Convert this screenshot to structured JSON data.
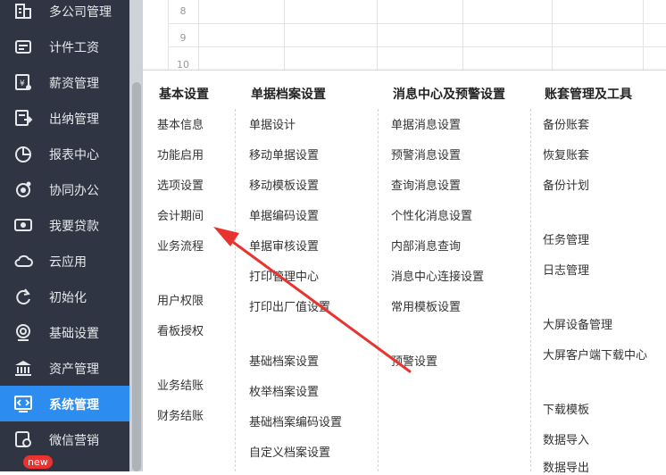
{
  "sidebar": {
    "items": [
      {
        "label": "多公司管理",
        "icon": "building-icon"
      },
      {
        "label": "计件工资",
        "icon": "wage-card-icon"
      },
      {
        "label": "薪资管理",
        "icon": "salary-icon"
      },
      {
        "label": "出纳管理",
        "icon": "cashier-icon"
      },
      {
        "label": "报表中心",
        "icon": "pie-chart-icon"
      },
      {
        "label": "协同办公",
        "icon": "collaboration-icon"
      },
      {
        "label": "我要贷款",
        "icon": "money-icon"
      },
      {
        "label": "云应用",
        "icon": "cloud-icon"
      },
      {
        "label": "初始化",
        "icon": "refresh-icon"
      },
      {
        "label": "基础设置",
        "icon": "settings-icon"
      },
      {
        "label": "资产管理",
        "icon": "bank-icon"
      },
      {
        "label": "系统管理",
        "icon": "code-window-icon"
      },
      {
        "label": "微信营销",
        "icon": "wechat-icon"
      }
    ],
    "active_index": 11,
    "badge": "new"
  },
  "grid": {
    "row_numbers": [
      "8",
      "9",
      "10"
    ]
  },
  "menu": {
    "columns": [
      {
        "title": "基本设置",
        "items": [
          "基本信息",
          "功能启用",
          "选项设置",
          "会计期间",
          "业务流程",
          "用户权限",
          "看板授权",
          "业务结账",
          "财务结账"
        ]
      },
      {
        "title": "单据档案设置",
        "items": [
          "单据设计",
          "移动单据设置",
          "移动模板设置",
          "单据编码设置",
          "单据审核设置",
          "打印管理中心",
          "打印出厂值设置",
          "基础档案设置",
          "枚举档案设置",
          "基础档案编码设置",
          "自定义档案设置"
        ]
      },
      {
        "title": "消息中心及预警设置",
        "items": [
          "单据消息设置",
          "预警消息设置",
          "查询消息设置",
          "个性化消息设置",
          "内部消息查询",
          "消息中心连接设置",
          "常用模板设置",
          "预警设置"
        ]
      },
      {
        "title": "账套管理及工具",
        "items": [
          "备份账套",
          "恢复账套",
          "备份计划",
          "任务管理",
          "日志管理",
          "大屏设备管理",
          "大屏客户端下载中心",
          "下载模板",
          "数据导入",
          "数据导出"
        ]
      }
    ]
  },
  "colors": {
    "sidebar_bg": "#2f3542",
    "active_bg": "#2d8cf0",
    "arrow": "#e8332e",
    "badge": "#e8332e"
  }
}
